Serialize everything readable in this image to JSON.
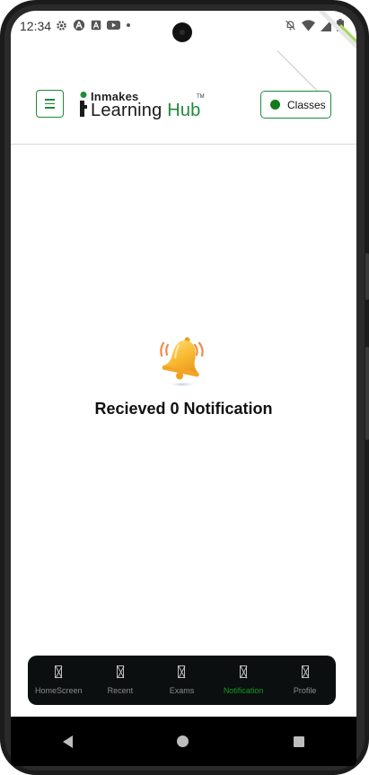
{
  "status_bar": {
    "time": "12:34",
    "left_icons": [
      "gear-icon",
      "android-icon",
      "a-icon",
      "youtube-icon",
      "dot-icon"
    ],
    "right_icons": [
      "bell-off-icon",
      "wifi-icon",
      "signal-icon",
      "battery-icon"
    ]
  },
  "header": {
    "menu_icon": "hamburger-icon",
    "logo_top": "Inmakes",
    "logo_learning": "Learning ",
    "logo_hub": "Hub",
    "logo_tm": "TM",
    "classes_label": "Classes",
    "accent_color": "#1f8a3b"
  },
  "empty_state": {
    "icon": "bell-icon",
    "message": "Recieved 0 Notification"
  },
  "bottom_nav": {
    "items": [
      {
        "label": "HomeScreen",
        "icon": "missing-glyph-icon",
        "active": false
      },
      {
        "label": "Recent",
        "icon": "missing-glyph-icon",
        "active": false
      },
      {
        "label": "Exams",
        "icon": "missing-glyph-icon",
        "active": false
      },
      {
        "label": "Notification",
        "icon": "missing-glyph-icon",
        "active": true
      },
      {
        "label": "Profile",
        "icon": "missing-glyph-icon",
        "active": false
      }
    ],
    "active_color": "#139b22"
  },
  "system_nav": [
    "back-icon",
    "home-icon",
    "recents-icon"
  ]
}
